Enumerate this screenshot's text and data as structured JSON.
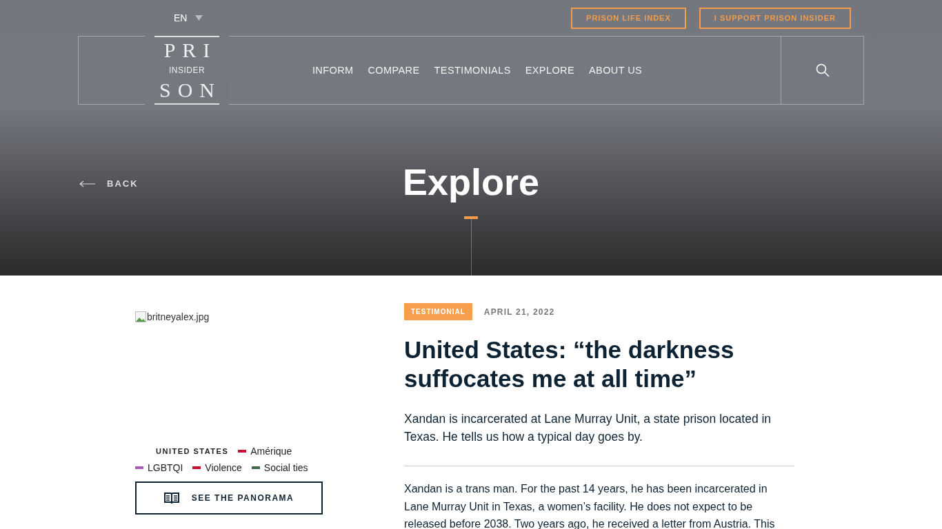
{
  "language": {
    "label": "EN"
  },
  "top_buttons": [
    "PRISON LIFE INDEX",
    "I SUPPORT PRISON INSIDER"
  ],
  "logo": {
    "top": "PRI",
    "middle": "INSIDER",
    "bottom": "SON"
  },
  "nav": [
    "INFORM",
    "COMPARE",
    "TESTIMONIALS",
    "EXPLORE",
    "ABOUT US"
  ],
  "back": "BACK",
  "page_title": "Explore",
  "image": {
    "alt": "britneyalex.jpg"
  },
  "country": "UNITED STATES",
  "tags": [
    {
      "label": "Amérique",
      "color": "#c8102e"
    },
    {
      "label": "LGBTQI",
      "color": "#a25fb5"
    },
    {
      "label": "Violence",
      "color": "#c8102e"
    },
    {
      "label": "Social ties",
      "color": "#3e6b48"
    }
  ],
  "panorama_button": "SEE THE PANORAMA",
  "article": {
    "badge": "TESTIMONIAL",
    "date": "APRIL 21, 2022",
    "title": "United States: “the darkness suffocates me at all time”",
    "lead": "Xandan is incarcerated at Lane Murray Unit, a state prison located in Texas. He tells us how a typical day goes by.",
    "body": "Xandan is a trans man. For the past 14 years, he has been incarcerated in Lane Murray Unit in Texas, a women’s facility. He does not expect to be released before 2038. Two years ago, he received a letter from Austria. This"
  }
}
